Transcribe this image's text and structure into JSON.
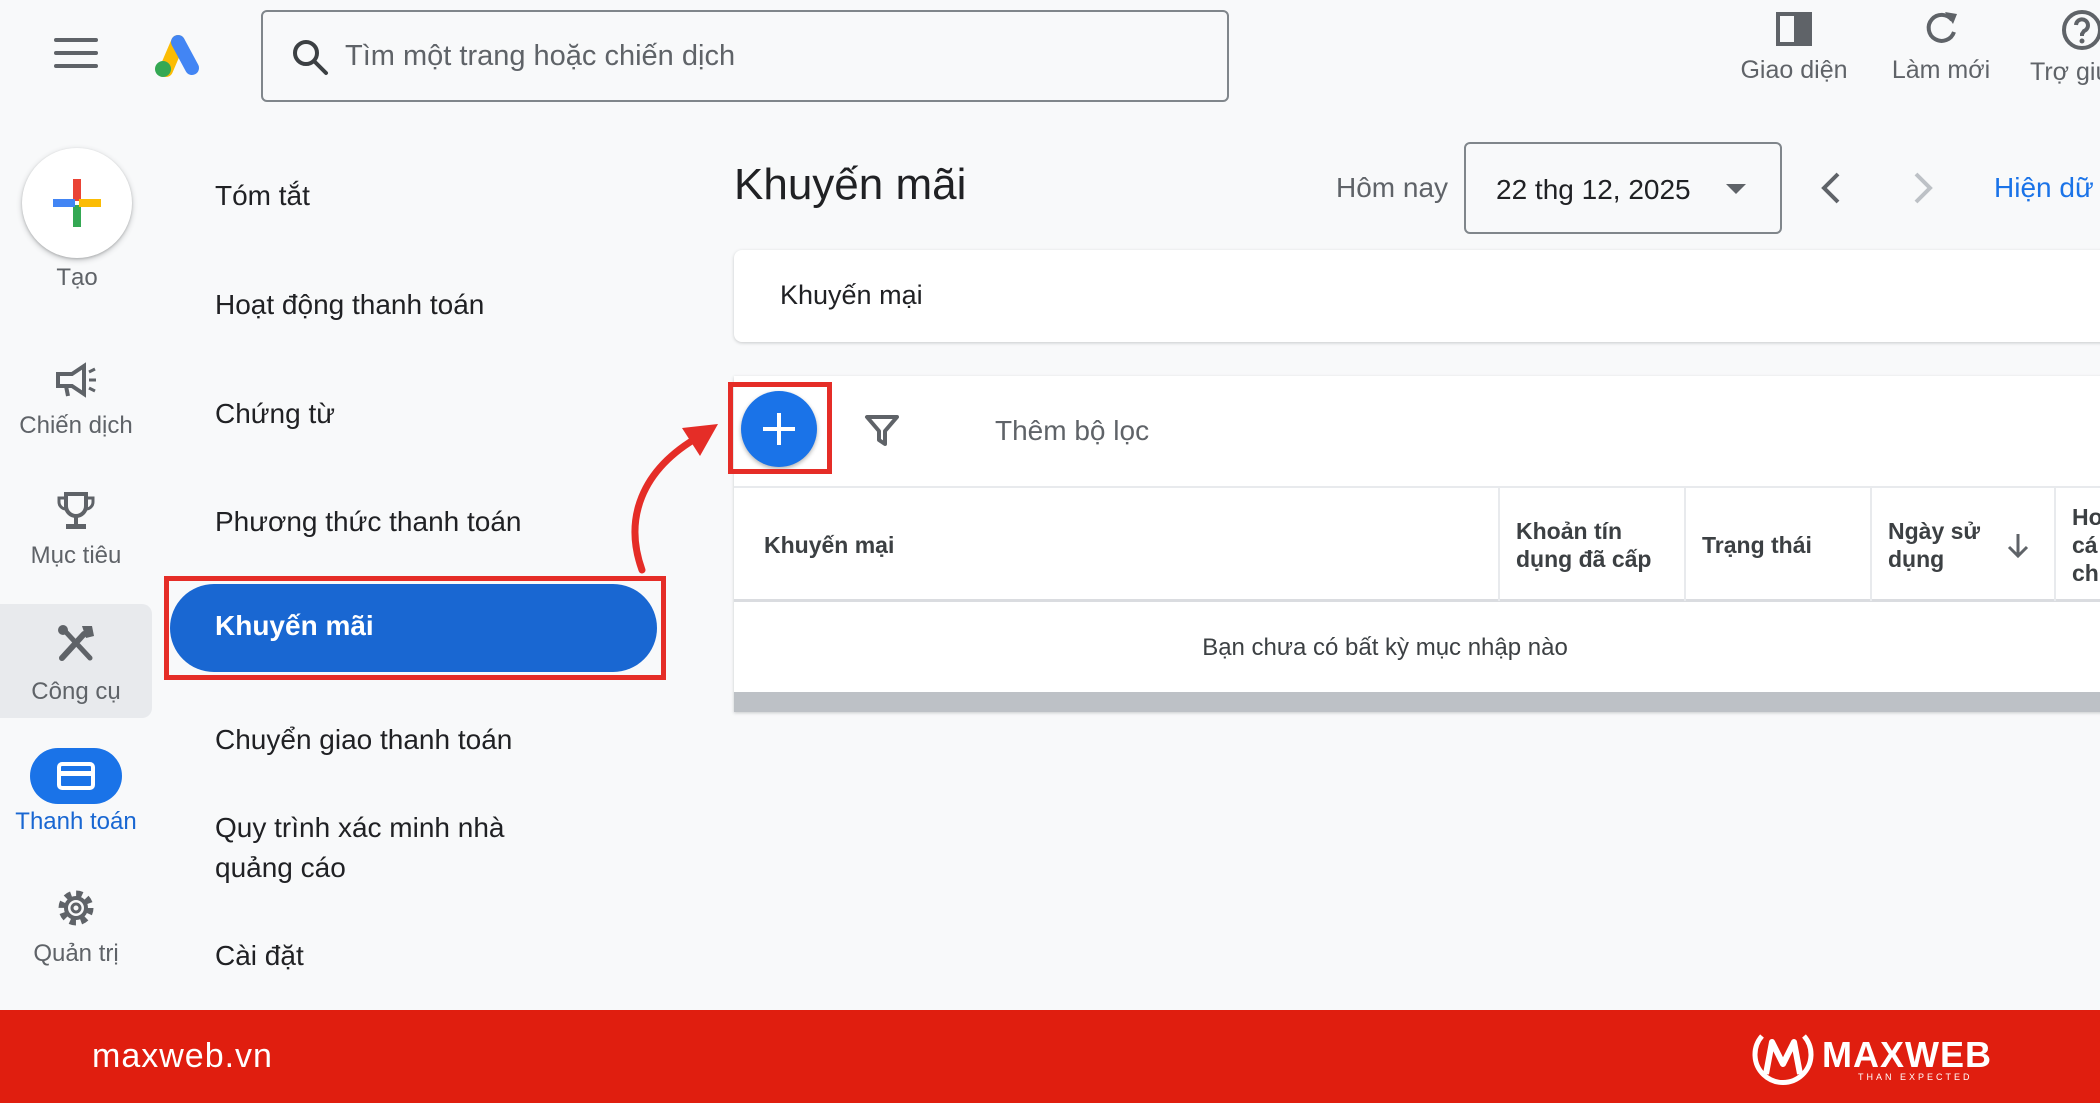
{
  "search": {
    "placeholder": "Tìm một trang hoặc chiến dịch"
  },
  "top_actions": [
    {
      "label": "Giao diện",
      "icon": "appearance-icon"
    },
    {
      "label": "Làm mới",
      "icon": "refresh-icon"
    },
    {
      "label": "Trợ giú",
      "icon": "help-icon"
    }
  ],
  "rail": {
    "create": "Tạo",
    "campaigns": "Chiến dịch",
    "goals": "Mục tiêu",
    "tools": "Công cụ",
    "billing": "Thanh toán",
    "admin": "Quản trị"
  },
  "subnav": {
    "summary": "Tóm tắt",
    "transactions": "Hoạt động thanh toán",
    "documents": "Chứng từ",
    "payment_methods": "Phương thức thanh toán",
    "promotions": "Khuyến mãi",
    "transfer": "Chuyển giao thanh toán",
    "verification_line1": "Quy trình xác minh nhà",
    "verification_line2": "quảng cáo",
    "settings": "Cài đặt"
  },
  "main": {
    "title": "Khuyến mãi",
    "date_label": "Hôm nay",
    "date_value": "22 thg 12, 2025",
    "show_data": "Hiện dữ l",
    "tab": "Khuyến mại",
    "filter_label": "Thêm bộ lọc",
    "columns": {
      "promotion": "Khuyến mại",
      "credit_line1": "Khoản tín",
      "credit_line2": "dụng đã cấp",
      "status": "Trạng thái",
      "usage_line1": "Ngày sử",
      "usage_line2": "dụng",
      "extra_line1": "Hơ",
      "extra_line2": "cá",
      "extra_line3": "ch"
    },
    "empty": "Bạn chưa có bất kỳ mục nhập nào"
  },
  "footer": {
    "url": "maxweb.vn",
    "brand": "MAXWEB",
    "tagline": "THAN EXPECTED"
  },
  "colors": {
    "accent_blue": "#1a73e8",
    "highlight_red": "#e52d27",
    "footer_red": "#e01e0f"
  }
}
